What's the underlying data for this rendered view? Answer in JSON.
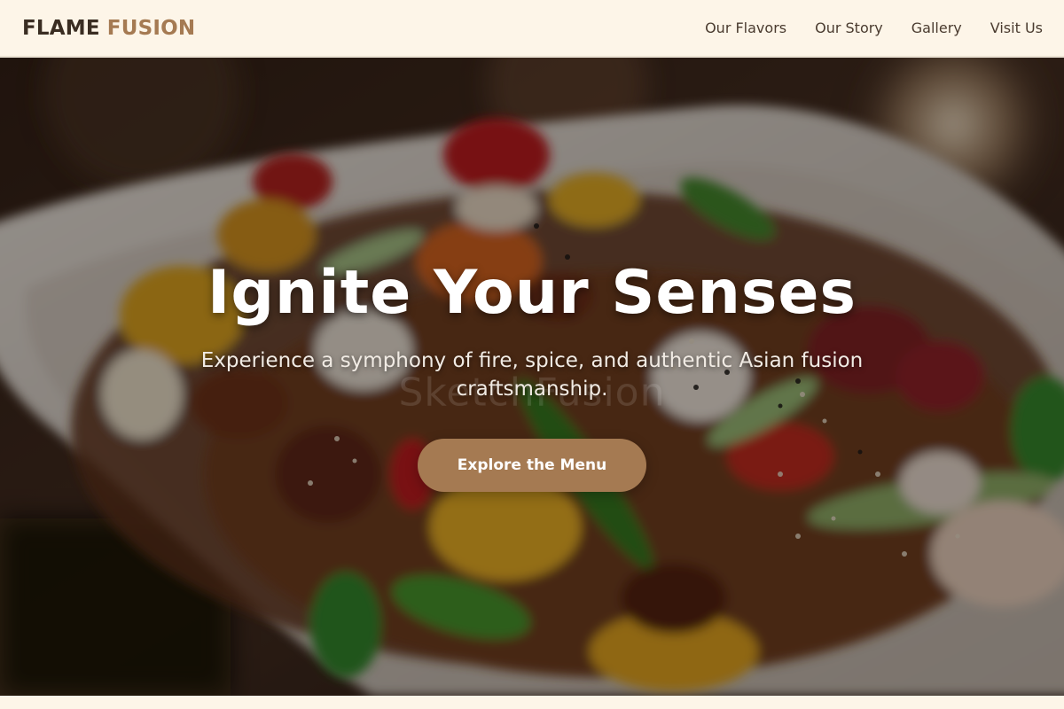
{
  "brand": {
    "name_part1": "FLAME",
    "name_part2": "FUSION"
  },
  "nav": {
    "items": [
      {
        "label": "Our Flavors"
      },
      {
        "label": "Our Story"
      },
      {
        "label": "Gallery"
      },
      {
        "label": "Visit Us"
      }
    ]
  },
  "hero": {
    "title": "Ignite Your Senses",
    "subtitle": "Experience a symphony of fire, spice, and authentic Asian fusion craftsmanship.",
    "cta_label": "Explore the Menu",
    "watermark": "SketchFusion"
  },
  "colors": {
    "background": "#fdf5e8",
    "brand_dark": "#3a2d22",
    "accent": "#a57a52",
    "nav_text": "#4a3b2f"
  }
}
